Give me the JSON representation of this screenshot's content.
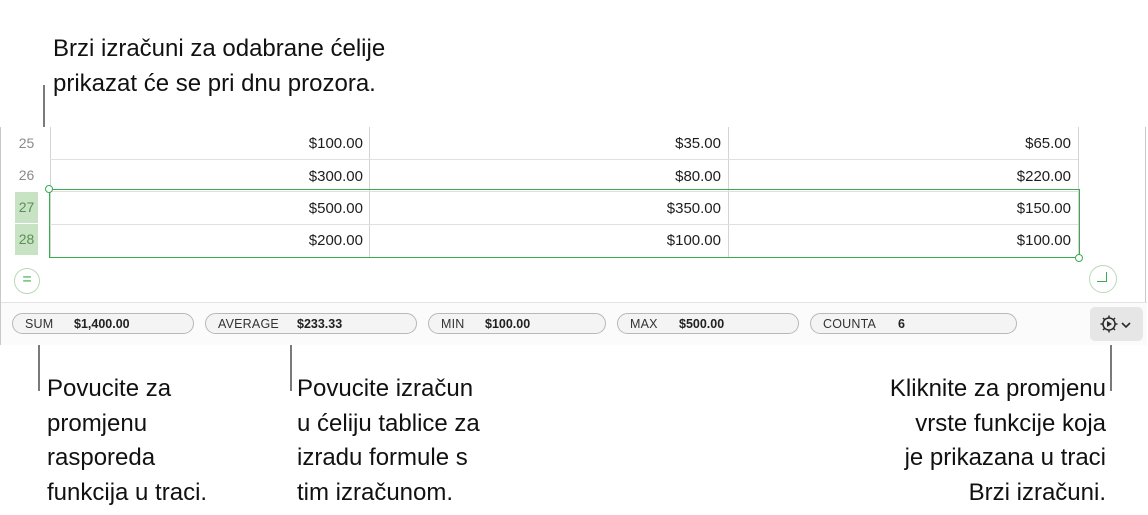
{
  "callouts": {
    "top": "Brzi izračuni za odabrane ćelije\nprikazat će se pri dnu prozora.",
    "drag_bar": "Povucite za\npromjenu\nrasporeda\nfunkcija u traci.",
    "drag_cell": "Povucite izračun\nu ćeliju tablice za\nizradu formule s\ntim izračunom.",
    "click_change": "Kliknite za promjenu\nvrste funkcije koja\nje prikazana u traci\nBrzi izračuni."
  },
  "table": {
    "rows": [
      {
        "num": "25",
        "selected": false,
        "cells": [
          "$100.00",
          "$35.00",
          "$65.00"
        ]
      },
      {
        "num": "26",
        "selected": false,
        "cells": [
          "$300.00",
          "$80.00",
          "$220.00"
        ]
      },
      {
        "num": "27",
        "selected": true,
        "cells": [
          "$500.00",
          "$350.00",
          "$150.00"
        ]
      },
      {
        "num": "28",
        "selected": true,
        "cells": [
          "$200.00",
          "$100.00",
          "$100.00"
        ]
      }
    ]
  },
  "buttons": {
    "equals_symbol": "=",
    "equals_icon": "equals-icon",
    "resize_icon": "corner-resize-icon",
    "settings_icon": "gear-icon",
    "dropdown_icon": "chevron-down-icon"
  },
  "quick_calc": [
    {
      "fn": "SUM",
      "value": "$1,400.00"
    },
    {
      "fn": "AVERAGE",
      "value": "$233.33"
    },
    {
      "fn": "MIN",
      "value": "$100.00"
    },
    {
      "fn": "MAX",
      "value": "$500.00"
    },
    {
      "fn": "COUNTA",
      "value": "6"
    }
  ],
  "colors": {
    "selection": "#3aab4e",
    "selected_row_header": "#c8e3c4"
  }
}
